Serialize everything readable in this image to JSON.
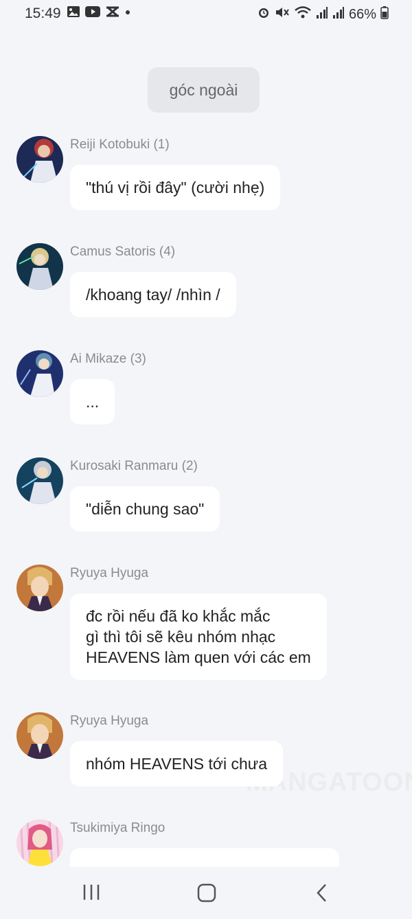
{
  "status_bar": {
    "time": "15:49",
    "battery": "66%",
    "left_icons": [
      "gallery-icon",
      "youtube-icon",
      "capcut-icon",
      "dot-icon"
    ],
    "right_icons": [
      "alarm-icon",
      "mute-icon",
      "wifi-icon",
      "signal-icon",
      "signal-icon",
      "battery-icon"
    ]
  },
  "chat": {
    "scene_label": "góc ngoài",
    "messages": [
      {
        "sender": "Reiji Kotobuki (1)",
        "text": "\"thú vị rồi đây\" (cười nhẹ)"
      },
      {
        "sender": "Camus Satoris (4)",
        "text": "/khoang tay/ /nhìn /"
      },
      {
        "sender": "Ai Mikaze (3)",
        "text": "..."
      },
      {
        "sender": "Kurosaki Ranmaru (2)",
        "text": "\"diễn chung sao\""
      },
      {
        "sender": "Ryuya Hyuga",
        "text": "đc rồi nếu đã ko khắc mắc\ngì thì tôi sẽ kêu nhóm nhạc\nHEAVENS làm quen với các em"
      },
      {
        "sender": "Ryuya Hyuga",
        "text": "nhóm HEAVENS tới chưa"
      },
      {
        "sender": "Tsukimiya Ringo",
        "text": ""
      }
    ],
    "watermark": "MANGATOON"
  },
  "nav": {
    "buttons": [
      "recent-apps",
      "home",
      "back"
    ]
  },
  "colors": {
    "background": "#f4f5f8",
    "bubble": "#ffffff",
    "sender_text": "#8b8b8b",
    "scene_pill": "#e6e7ea"
  }
}
